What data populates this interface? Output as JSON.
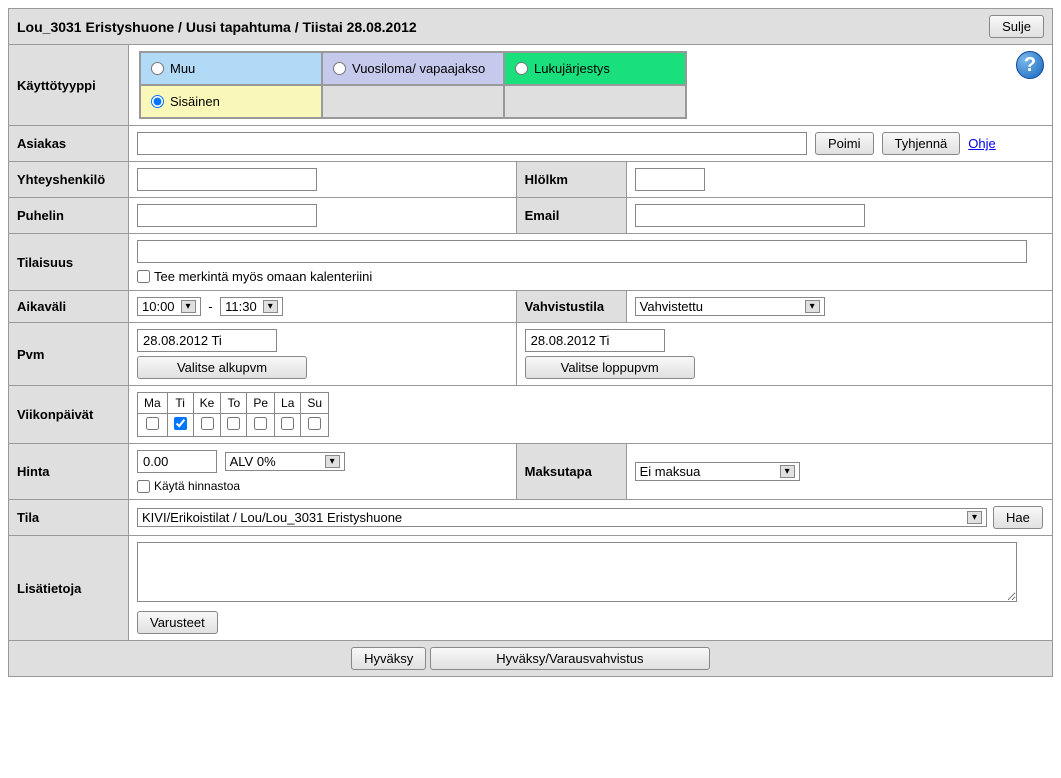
{
  "header": {
    "title": "Lou_3031 Eristyshuone / Uusi tapahtuma / Tiistai 28.08.2012",
    "close": "Sulje"
  },
  "labels": {
    "type": "Käyttötyyppi",
    "customer": "Asiakas",
    "contact": "Yhteyshenkilö",
    "people": "Hlölkm",
    "phone": "Puhelin",
    "email": "Email",
    "event": "Tilaisuus",
    "timerange": "Aikaväli",
    "confirm": "Vahvistustila",
    "date": "Pvm",
    "weekdays": "Viikonpäivät",
    "price": "Hinta",
    "paymethod": "Maksutapa",
    "room": "Tila",
    "notes": "Lisätietoja"
  },
  "types": {
    "muu": "Muu",
    "vuosiloma": "Vuosiloma/ vapaajakso",
    "lukujarjestys": "Lukujärjestys",
    "sisainen": "Sisäinen"
  },
  "buttons": {
    "pick": "Poimi",
    "clear": "Tyhjennä",
    "help": "Ohje",
    "startdate": "Valitse alkupvm",
    "enddate": "Valitse loppupvm",
    "search": "Hae",
    "equipment": "Varusteet",
    "accept": "Hyväksy",
    "acceptconfirm": "Hyväksy/Varausvahvistus"
  },
  "values": {
    "owncal": "Tee merkintä myös omaan kalenteriini",
    "timestart": "10:00",
    "timeend": "11:30",
    "dash": "-",
    "confirmed": "Vahvistettu",
    "date1": "28.08.2012 Ti",
    "date2": "28.08.2012 Ti",
    "price": "0.00",
    "vat": "ALV 0%",
    "usepricelist": "Käytä hinnastoa",
    "nopay": "Ei maksua",
    "room": "KIVI/Erikoistilat / Lou/Lou_3031 Eristyshuone"
  },
  "days": {
    "ma": "Ma",
    "ti": "Ti",
    "ke": "Ke",
    "to": "To",
    "pe": "Pe",
    "la": "La",
    "su": "Su"
  }
}
